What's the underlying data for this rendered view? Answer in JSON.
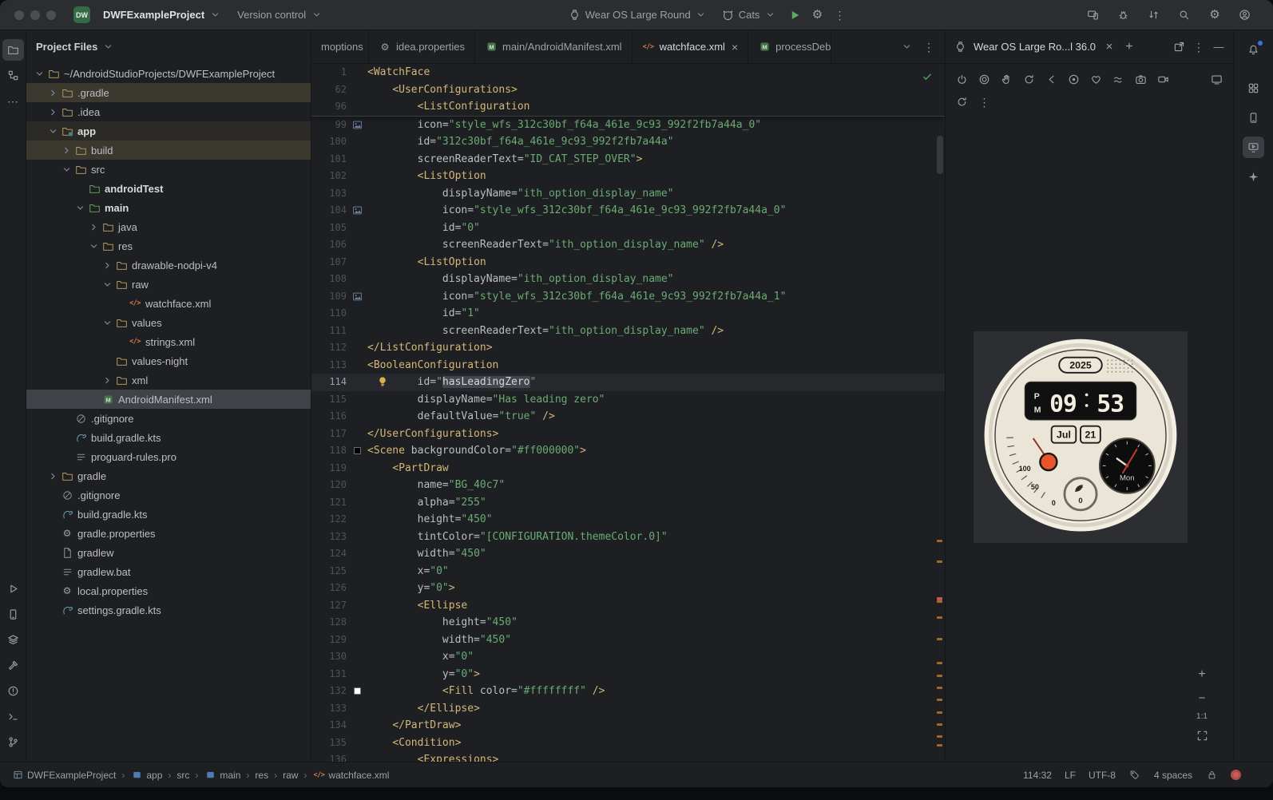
{
  "colors": {
    "accent_run_green": "#5fa865",
    "string_green": "#6aab73",
    "tag_yellow": "#d5b778",
    "stripe_orange": "#a06a2c",
    "error_red": "#cf5b56",
    "watch_orange": "#e8552c",
    "selection_gray": "#3f4246"
  },
  "titlebar": {
    "project_badge": "DW",
    "project_name": "DWFExampleProject",
    "version_control_label": "Version control",
    "device_selector": "Wear OS Large Round",
    "run_config": "Cats",
    "right_icons": [
      {
        "name": "device-mirror-icon",
        "icon": "device-mirror-icon"
      },
      {
        "name": "bug-report-icon",
        "icon": "bug-report-icon"
      },
      {
        "name": "sync-project-icon",
        "icon": "sync-project-icon"
      },
      {
        "name": "search-everywhere-icon",
        "icon": "search-everywhere-icon"
      },
      {
        "name": "settings-gear-icon",
        "icon": "settings-gear-icon"
      },
      {
        "name": "profile-avatar-icon",
        "icon": "profile-avatar-icon"
      }
    ]
  },
  "left_strip": {
    "top": [
      {
        "name": "project-tool-button",
        "icon": "folder-tool-icon",
        "active": true
      },
      {
        "name": "structure-tool-button",
        "icon": "structure-icon"
      },
      {
        "name": "more-tool-windows-button",
        "icon": "ellipsis-icon"
      }
    ],
    "bottom": [
      {
        "name": "run-tool-button",
        "icon": "play-outline-icon"
      },
      {
        "name": "device-tool-button",
        "icon": "phone-icon"
      },
      {
        "name": "profiler-tool-button",
        "icon": "layers-icon"
      },
      {
        "name": "build-tool-button",
        "icon": "hammer-icon"
      },
      {
        "name": "problems-tool-button",
        "icon": "problems-icon"
      },
      {
        "name": "terminal-tool-button",
        "icon": "terminal-icon"
      },
      {
        "name": "version-control-tool-button",
        "icon": "git-branch-icon"
      }
    ]
  },
  "project_panel": {
    "title": "Project Files",
    "tree": [
      {
        "i": 0,
        "c": "d",
        "ic": "folder-icon",
        "l": "~/AndroidStudioProjects/DWFExampleProject"
      },
      {
        "i": 1,
        "c": "r",
        "ic": "folder-icon",
        "l": ".gradle",
        "row": "t1"
      },
      {
        "i": 1,
        "c": "r",
        "ic": "folder-icon",
        "l": ".idea"
      },
      {
        "i": 1,
        "c": "d",
        "ic": "module-folder-icon",
        "l": "app",
        "b": true,
        "row": "t2"
      },
      {
        "i": 2,
        "c": "r",
        "ic": "folder-icon",
        "l": "build",
        "row": "t1"
      },
      {
        "i": 2,
        "c": "d",
        "ic": "folder-icon",
        "l": "src"
      },
      {
        "i": 3,
        "c": null,
        "ic": "folder-green-icon",
        "l": "androidTest",
        "b": true
      },
      {
        "i": 3,
        "c": "d",
        "ic": "folder-green-icon",
        "l": "main",
        "b": true
      },
      {
        "i": 4,
        "c": "r",
        "ic": "folder-icon",
        "l": "java"
      },
      {
        "i": 4,
        "c": "d",
        "ic": "folder-icon",
        "l": "res"
      },
      {
        "i": 5,
        "c": "r",
        "ic": "folder-icon",
        "l": "drawable-nodpi-v4"
      },
      {
        "i": 5,
        "c": "d",
        "ic": "folder-icon",
        "l": "raw"
      },
      {
        "i": 6,
        "c": null,
        "ic": "xml-file-icon",
        "l": "watchface.xml"
      },
      {
        "i": 5,
        "c": "d",
        "ic": "folder-icon",
        "l": "values"
      },
      {
        "i": 6,
        "c": null,
        "ic": "xml-file-icon",
        "l": "strings.xml"
      },
      {
        "i": 5,
        "c": null,
        "ic": "folder-icon",
        "l": "values-night"
      },
      {
        "i": 5,
        "c": "r",
        "ic": "folder-icon",
        "l": "xml"
      },
      {
        "i": 4,
        "c": null,
        "ic": "manifest-file-icon",
        "l": "AndroidManifest.xml",
        "sel": true
      },
      {
        "i": 2,
        "c": null,
        "ic": "ignore-icon",
        "l": ".gitignore"
      },
      {
        "i": 2,
        "c": null,
        "ic": "gradle-file-icon",
        "l": "build.gradle.kts"
      },
      {
        "i": 2,
        "c": null,
        "ic": "text-file-icon",
        "l": "proguard-rules.pro"
      },
      {
        "i": 1,
        "c": "r",
        "ic": "folder-icon",
        "l": "gradle"
      },
      {
        "i": 1,
        "c": null,
        "ic": "ignore-icon",
        "l": ".gitignore"
      },
      {
        "i": 1,
        "c": null,
        "ic": "gradle-file-icon",
        "l": "build.gradle.kts"
      },
      {
        "i": 1,
        "c": null,
        "ic": "properties-file-icon",
        "l": "gradle.properties"
      },
      {
        "i": 1,
        "c": null,
        "ic": "file-icon",
        "l": "gradlew"
      },
      {
        "i": 1,
        "c": null,
        "ic": "text-file-icon",
        "l": "gradlew.bat"
      },
      {
        "i": 1,
        "c": null,
        "ic": "properties-file-icon",
        "l": "local.properties"
      },
      {
        "i": 1,
        "c": null,
        "ic": "gradle-file-icon",
        "l": "settings.gradle.kts"
      }
    ]
  },
  "editor": {
    "tabs": [
      {
        "id": "moptions",
        "label": "moptions",
        "trunc": "start"
      },
      {
        "id": "idea-properties",
        "label": "idea.properties",
        "icon": "gear-file-icon"
      },
      {
        "id": "android-manifest",
        "label": "main/AndroidManifest.xml",
        "icon": "manifest-file-icon"
      },
      {
        "id": "watchface",
        "label": "watchface.xml",
        "icon": "xml-file-icon",
        "active": true,
        "close": true
      },
      {
        "id": "process-debug",
        "label": "processDebug",
        "icon": "manifest-file-icon",
        "trunc": "end"
      }
    ],
    "sticky": [
      {
        "n": "1",
        "i": 0,
        "s": [
          [
            "t",
            "<WatchFace"
          ]
        ]
      },
      {
        "n": "62",
        "i": 4,
        "s": [
          [
            "t",
            "<UserConfigurations>"
          ]
        ]
      },
      {
        "n": "96",
        "i": 8,
        "s": [
          [
            "t",
            "<ListConfiguration"
          ]
        ]
      }
    ],
    "lines": [
      {
        "n": "99",
        "i": 8,
        "g": "img",
        "s": [
          [
            "a",
            "icon="
          ],
          [
            "v",
            "\"style_wfs_312c30bf_f64a_461e_9c93_992f2fb7a44a_0\""
          ]
        ]
      },
      {
        "n": "100",
        "i": 8,
        "s": [
          [
            "a",
            "id="
          ],
          [
            "v",
            "\"312c30bf_f64a_461e_9c93_992f2fb7a44a\""
          ]
        ]
      },
      {
        "n": "101",
        "i": 8,
        "s": [
          [
            "a",
            "screenReaderText="
          ],
          [
            "v",
            "\"ID_CAT_STEP_OVER\""
          ],
          [
            "t",
            ">"
          ]
        ]
      },
      {
        "n": "102",
        "i": 8,
        "s": [
          [
            "t",
            "<ListOption"
          ]
        ]
      },
      {
        "n": "103",
        "i": 12,
        "s": [
          [
            "a",
            "displayName="
          ],
          [
            "v",
            "\"ith_option_display_name\""
          ]
        ]
      },
      {
        "n": "104",
        "i": 12,
        "g": "img",
        "s": [
          [
            "a",
            "icon="
          ],
          [
            "v",
            "\"style_wfs_312c30bf_f64a_461e_9c93_992f2fb7a44a_0\""
          ]
        ]
      },
      {
        "n": "105",
        "i": 12,
        "s": [
          [
            "a",
            "id="
          ],
          [
            "v",
            "\"0\""
          ]
        ]
      },
      {
        "n": "106",
        "i": 12,
        "s": [
          [
            "a",
            "screenReaderText="
          ],
          [
            "v",
            "\"ith_option_display_name\""
          ],
          [
            "p",
            " "
          ],
          [
            "t",
            "/>"
          ]
        ]
      },
      {
        "n": "107",
        "i": 8,
        "s": [
          [
            "t",
            "<ListOption"
          ]
        ]
      },
      {
        "n": "108",
        "i": 12,
        "s": [
          [
            "a",
            "displayName="
          ],
          [
            "v",
            "\"ith_option_display_name\""
          ]
        ]
      },
      {
        "n": "109",
        "i": 12,
        "g": "img",
        "s": [
          [
            "a",
            "icon="
          ],
          [
            "v",
            "\"style_wfs_312c30bf_f64a_461e_9c93_992f2fb7a44a_1\""
          ]
        ]
      },
      {
        "n": "110",
        "i": 12,
        "s": [
          [
            "a",
            "id="
          ],
          [
            "v",
            "\"1\""
          ]
        ]
      },
      {
        "n": "111",
        "i": 12,
        "s": [
          [
            "a",
            "screenReaderText="
          ],
          [
            "v",
            "\"ith_option_display_name\""
          ],
          [
            "p",
            " "
          ],
          [
            "t",
            "/>"
          ]
        ]
      },
      {
        "n": "112",
        "i": 0,
        "s": [
          [
            "t",
            "</ListConfiguration>"
          ]
        ]
      },
      {
        "n": "113",
        "i": 0,
        "s": [
          [
            "t",
            "<BooleanConfiguration"
          ]
        ]
      },
      {
        "n": "114",
        "i": 8,
        "g": "bulb",
        "h": true,
        "s": [
          [
            "a",
            "id="
          ],
          [
            "v",
            "\""
          ],
          [
            "sel",
            "hasLeadingZero"
          ],
          [
            "v",
            "\""
          ]
        ]
      },
      {
        "n": "115",
        "i": 8,
        "s": [
          [
            "a",
            "displayName="
          ],
          [
            "v",
            "\"Has leading zero\""
          ]
        ]
      },
      {
        "n": "116",
        "i": 8,
        "s": [
          [
            "a",
            "defaultValue="
          ],
          [
            "v",
            "\"true\""
          ],
          [
            "p",
            " "
          ],
          [
            "t",
            "/>"
          ]
        ]
      },
      {
        "n": "117",
        "i": 0,
        "s": [
          [
            "t",
            "</UserConfigurations>"
          ]
        ]
      },
      {
        "n": "118",
        "i": 0,
        "g": "cd",
        "s": [
          [
            "t",
            "<Scene"
          ],
          [
            "p",
            " "
          ],
          [
            "a",
            "backgroundColor="
          ],
          [
            "v",
            "\"#ff000000\""
          ],
          [
            "t",
            ">"
          ]
        ]
      },
      {
        "n": "119",
        "i": 4,
        "s": [
          [
            "t",
            "<PartDraw"
          ]
        ]
      },
      {
        "n": "120",
        "i": 8,
        "s": [
          [
            "a",
            "name="
          ],
          [
            "v",
            "\"BG_40c7\""
          ]
        ]
      },
      {
        "n": "121",
        "i": 8,
        "s": [
          [
            "a",
            "alpha="
          ],
          [
            "v",
            "\"255\""
          ]
        ]
      },
      {
        "n": "122",
        "i": 8,
        "s": [
          [
            "a",
            "height="
          ],
          [
            "v",
            "\"450\""
          ]
        ]
      },
      {
        "n": "123",
        "i": 8,
        "s": [
          [
            "a",
            "tintColor="
          ],
          [
            "v",
            "\"[CONFIGURATION.themeColor.0]\""
          ]
        ]
      },
      {
        "n": "124",
        "i": 8,
        "s": [
          [
            "a",
            "width="
          ],
          [
            "v",
            "\"450\""
          ]
        ]
      },
      {
        "n": "125",
        "i": 8,
        "s": [
          [
            "a",
            "x="
          ],
          [
            "v",
            "\"0\""
          ]
        ]
      },
      {
        "n": "126",
        "i": 8,
        "s": [
          [
            "a",
            "y="
          ],
          [
            "v",
            "\"0\""
          ],
          [
            "t",
            ">"
          ]
        ]
      },
      {
        "n": "127",
        "i": 8,
        "s": [
          [
            "t",
            "<Ellipse"
          ]
        ]
      },
      {
        "n": "128",
        "i": 12,
        "s": [
          [
            "a",
            "height="
          ],
          [
            "v",
            "\"450\""
          ]
        ]
      },
      {
        "n": "129",
        "i": 12,
        "s": [
          [
            "a",
            "width="
          ],
          [
            "v",
            "\"450\""
          ]
        ]
      },
      {
        "n": "130",
        "i": 12,
        "s": [
          [
            "a",
            "x="
          ],
          [
            "v",
            "\"0\""
          ]
        ]
      },
      {
        "n": "131",
        "i": 12,
        "s": [
          [
            "a",
            "y="
          ],
          [
            "v",
            "\"0\""
          ],
          [
            "t",
            ">"
          ]
        ]
      },
      {
        "n": "132",
        "i": 12,
        "g": "cl",
        "s": [
          [
            "t",
            "<Fill"
          ],
          [
            "p",
            " "
          ],
          [
            "a",
            "color="
          ],
          [
            "v",
            "\"#ffffffff\""
          ],
          [
            "p",
            " "
          ],
          [
            "t",
            "/>"
          ]
        ]
      },
      {
        "n": "133",
        "i": 8,
        "s": [
          [
            "t",
            "</Ellipse>"
          ]
        ]
      },
      {
        "n": "134",
        "i": 4,
        "s": [
          [
            "t",
            "</PartDraw>"
          ]
        ]
      },
      {
        "n": "135",
        "i": 4,
        "s": [
          [
            "t",
            "<Condition>"
          ]
        ]
      },
      {
        "n": "136",
        "i": 8,
        "s": [
          [
            "t",
            "<Expressions>"
          ]
        ]
      }
    ]
  },
  "device_panel": {
    "tab_title": "Wear OS Large Ro...l 36.0",
    "toolbar_row1": [
      {
        "name": "power-button",
        "icon": "power-icon"
      },
      {
        "name": "screen-button",
        "icon": "round-screen-icon"
      },
      {
        "name": "palm-button",
        "icon": "palm-icon"
      },
      {
        "name": "rotate-button",
        "icon": "rotate-icon"
      },
      {
        "name": "back-button",
        "icon": "back-icon"
      },
      {
        "name": "press-button",
        "icon": "press-icon"
      },
      {
        "name": "heart-rate-button",
        "icon": "heart-icon"
      },
      {
        "name": "tilt-button",
        "icon": "tilt-icon"
      },
      {
        "name": "screenshot-button",
        "icon": "camera-icon"
      },
      {
        "name": "record-button",
        "icon": "video-icon"
      }
    ],
    "toolbar_row1_right": [
      {
        "name": "mirror-button",
        "icon": "cast-icon"
      }
    ],
    "toolbar_row2": [
      {
        "name": "reset-view-button",
        "icon": "rotate-icon"
      },
      {
        "name": "device-more-button",
        "icon": "kebab-icon"
      }
    ],
    "zoom_reset_label": "1:1",
    "watch": {
      "year": "2025",
      "hour": "09",
      "minute": "53",
      "ampm": "PM",
      "month": "Jul",
      "day": "21",
      "weekday": "Mon",
      "gauge": [
        "100",
        "50",
        "0"
      ],
      "bottom_value": "0"
    }
  },
  "right_strip": {
    "icons": [
      {
        "name": "notifications-button",
        "icon": "bell-icon",
        "badge": true
      },
      {
        "name": "device-explorer-button",
        "icon": "grid-icon"
      },
      {
        "name": "device-manager-button",
        "icon": "phone-icon"
      },
      {
        "name": "running-devices-button",
        "icon": "running-devices-icon",
        "active": true
      },
      {
        "name": "gemini-button",
        "icon": "sparkle-icon"
      }
    ]
  },
  "status_bar": {
    "breadcrumbs": [
      {
        "label": "DWFExampleProject",
        "icon": "project-window-icon"
      },
      {
        "label": "app",
        "icon": "module-blue-icon"
      },
      {
        "label": "src"
      },
      {
        "label": "main",
        "icon": "module-blue-icon"
      },
      {
        "label": "res"
      },
      {
        "label": "raw"
      },
      {
        "label": "watchface.xml",
        "icon": "xml-file-icon"
      }
    ],
    "caret_position": "114:32",
    "line_separator": "LF",
    "encoding": "UTF-8",
    "indent_style": "4 spaces"
  }
}
